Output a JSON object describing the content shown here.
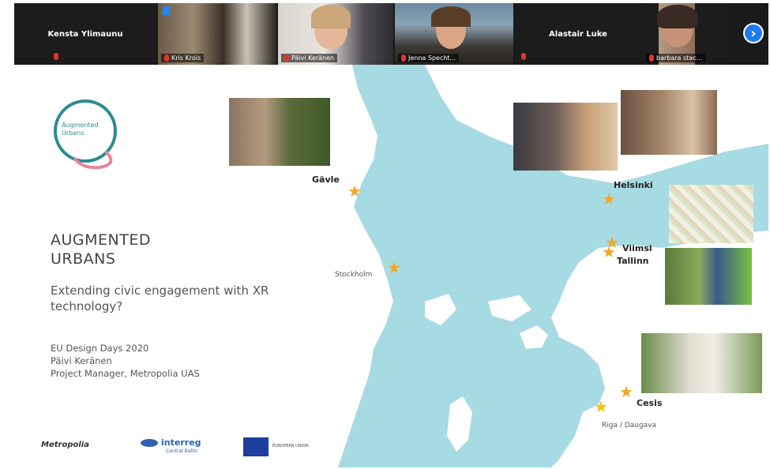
{
  "participants": [
    {
      "name": "Kensta Ylimaunu",
      "muted": true
    },
    {
      "name": "Kris Krois",
      "muted": true
    },
    {
      "name": "Päivi Keränen",
      "muted": true
    },
    {
      "name": "Jenna Specht...",
      "muted": true
    },
    {
      "name": "Alastair Luke",
      "muted": true
    },
    {
      "name": "barbara stac...",
      "muted": true
    }
  ],
  "next_page_icon": "chevron-right-icon",
  "slide": {
    "logo_text": "Augmented Urbans",
    "title_line1": "AUGMENTED",
    "title_line2": "URBANS",
    "subtitle": "Extending civic engagement with XR technology?",
    "event_line1": "EU Design Days 2020",
    "event_line2": "Päivi Keränen",
    "event_line3": "Project Manager, Metropolia UAS",
    "cities": {
      "gavle": "Gävle",
      "helsinki": "Helsinki",
      "viimsi": "Viimsi",
      "tallinn": "Tallinn",
      "stockholm": "Stockholm",
      "cesis": "Cesis",
      "riga": "Riga / Daugava"
    },
    "footer": {
      "metropolia": "Metropolia",
      "interreg": "interreg",
      "interreg_sub": "Central Baltic",
      "eu": "EUROPEAN UNION"
    }
  },
  "colors": {
    "sea": "#a7dbe3",
    "star_orange": "#f5a623",
    "star_yellow": "#f4c20d",
    "logo_teal": "#2b8a92",
    "logo_pink": "#e8849a",
    "accent_blue": "#1e7cf0",
    "mic_red": "#e0372d"
  }
}
